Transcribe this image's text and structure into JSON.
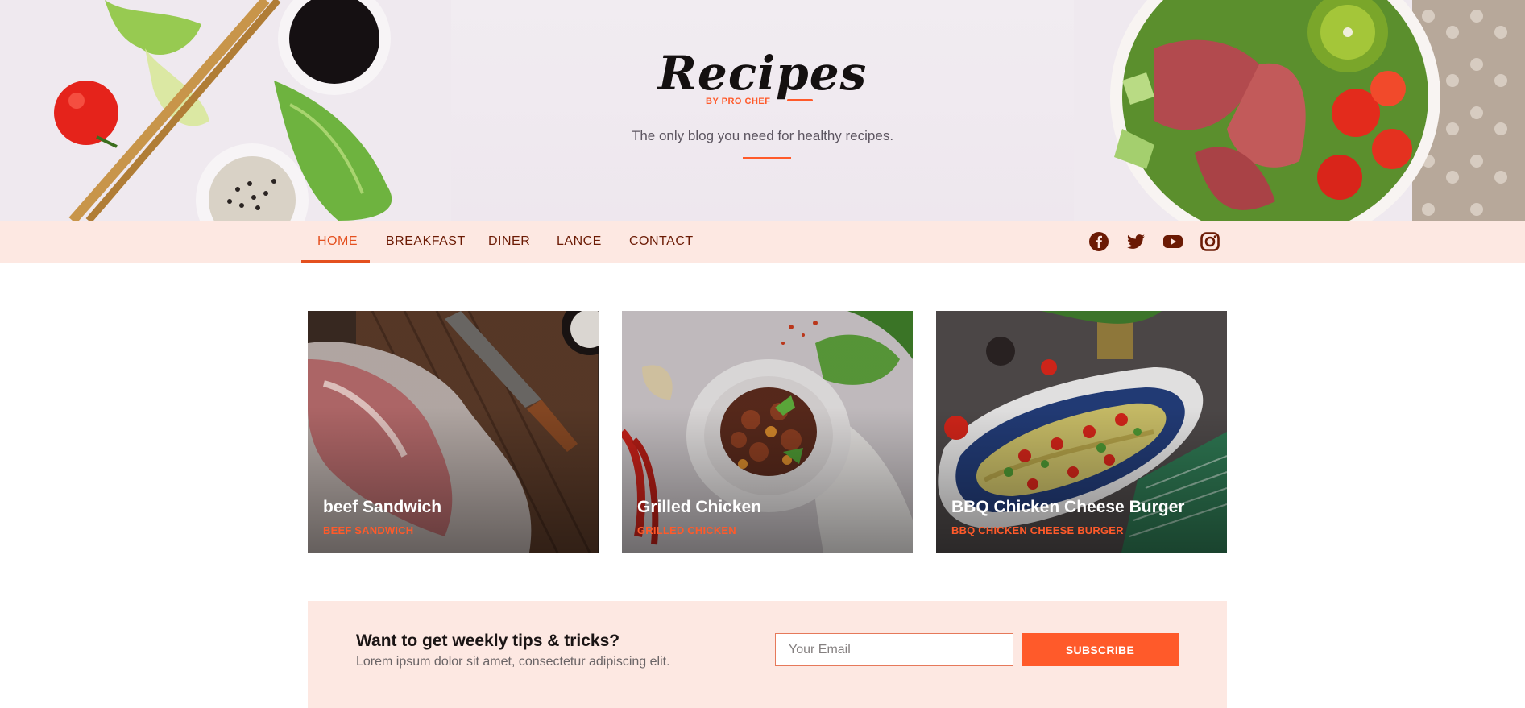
{
  "brand": {
    "logo_text": "Recipes",
    "logo_sub": "BY PRO CHEF",
    "tagline": "The only blog you need for healthy recipes.",
    "accent": "#ff5a2a",
    "nav_bg": "#fde8e2"
  },
  "nav": {
    "items": [
      {
        "label": "HOME",
        "active": true
      },
      {
        "label": "BREAKFAST"
      },
      {
        "label": "DINER"
      },
      {
        "label": "LANCE"
      },
      {
        "label": "CONTACT"
      }
    ],
    "social": [
      "facebook-icon",
      "twitter-icon",
      "youtube-icon",
      "instagram-icon"
    ]
  },
  "cards": [
    {
      "title": "beef Sandwich",
      "category": "BEEF SANDWICH"
    },
    {
      "title": "Grilled Chicken",
      "category": "GRILLED CHICKEN"
    },
    {
      "title": "BBQ Chicken Cheese Burger",
      "category": "BBQ CHICKEN CHEESE BURGER"
    }
  ],
  "newsletter": {
    "title": "Want to get weekly tips & tricks?",
    "text": "Lorem ipsum dolor sit amet, consectetur adipiscing elit.",
    "email_placeholder": "Your Email",
    "button_label": "SUBSCRIBE"
  }
}
